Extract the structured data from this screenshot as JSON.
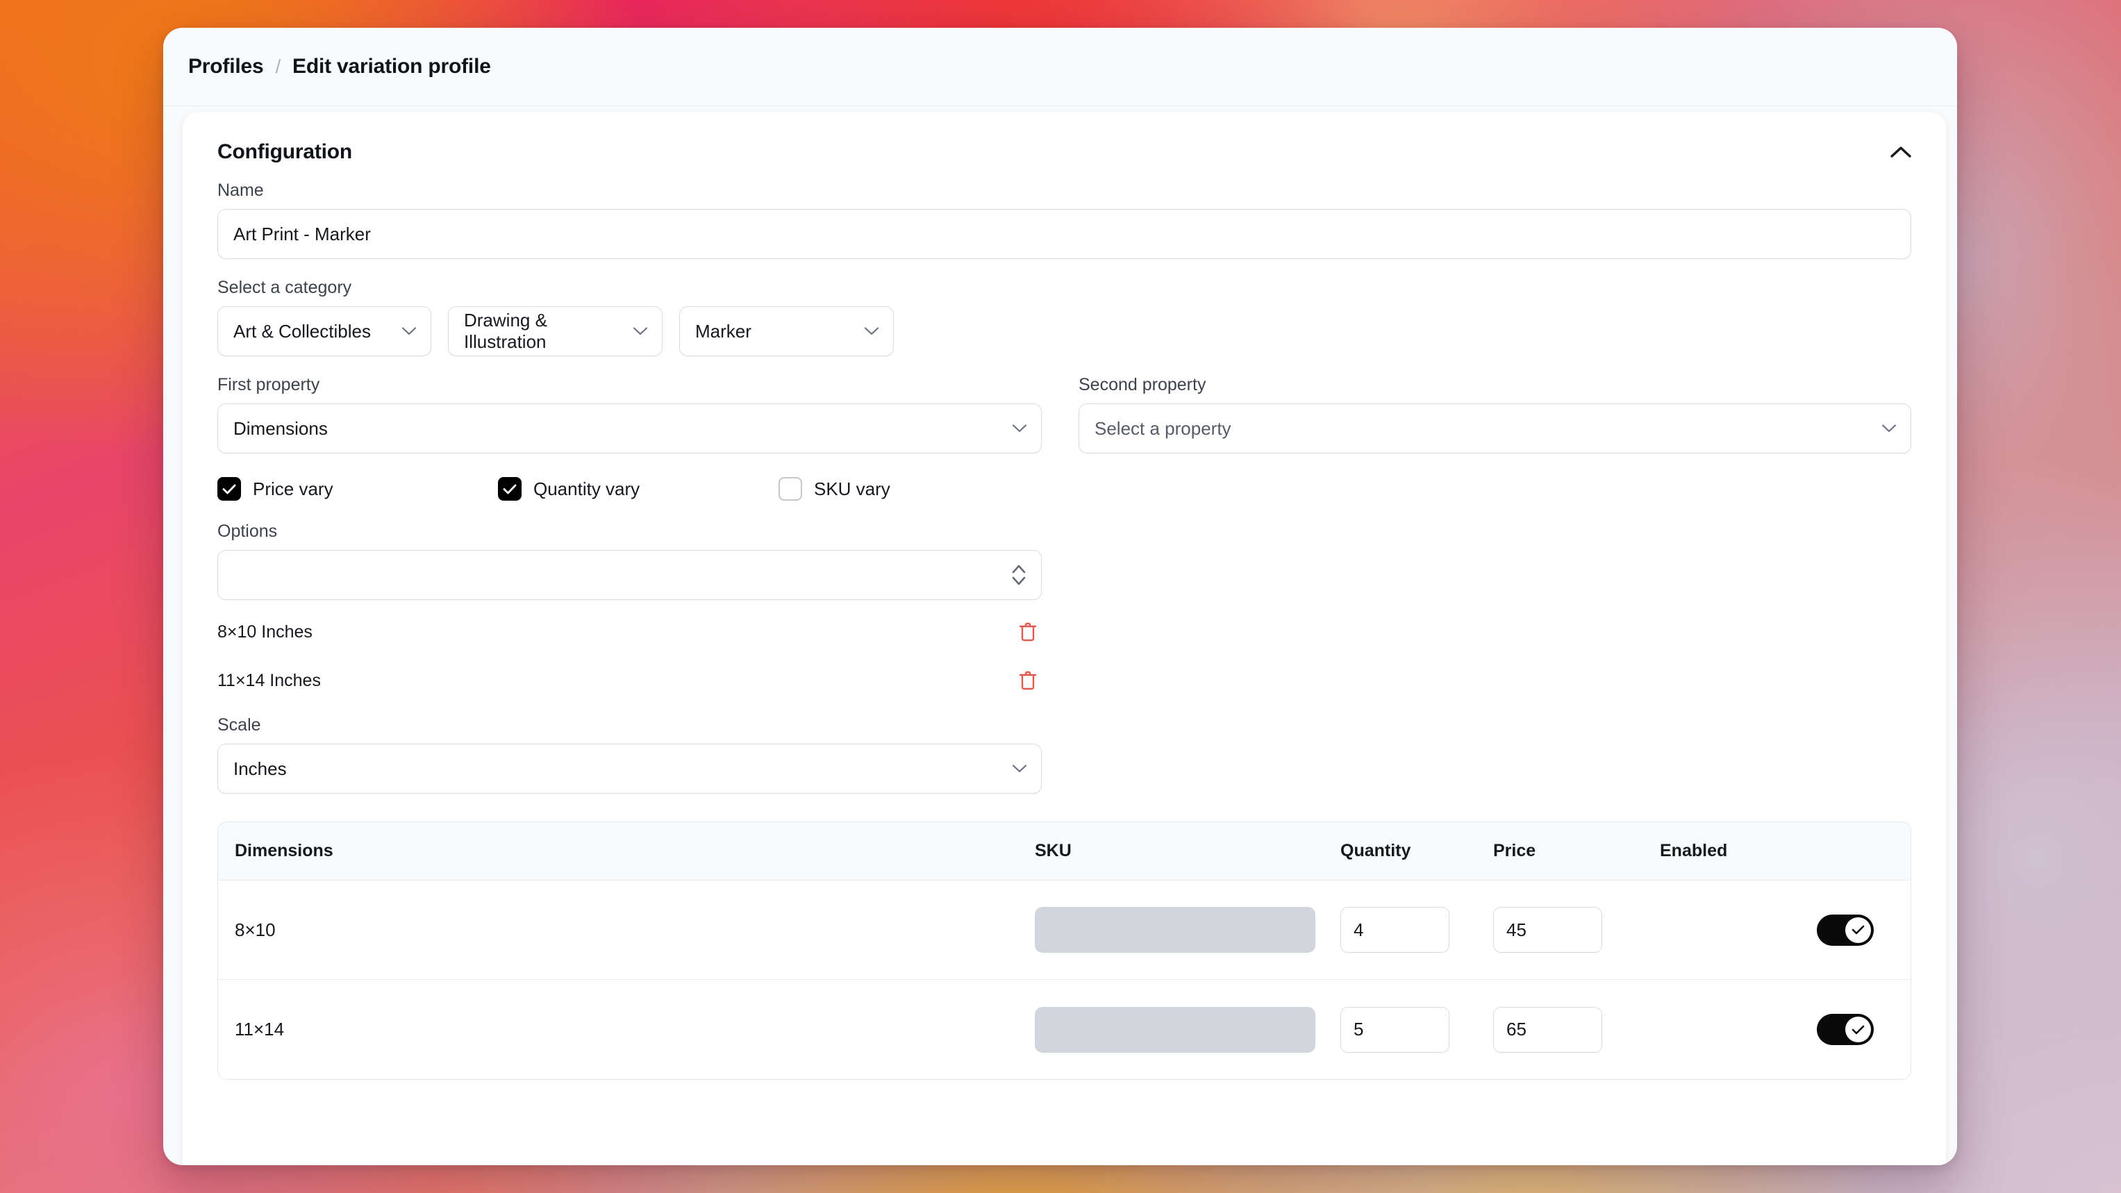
{
  "breadcrumb": {
    "root": "Profiles",
    "separator": "/",
    "current": "Edit variation profile"
  },
  "panel": {
    "title": "Configuration",
    "collapse_icon": "chevron-up-icon"
  },
  "form": {
    "name": {
      "label": "Name",
      "value": "Art Print - Marker"
    },
    "category": {
      "label": "Select a category",
      "selects": [
        {
          "value": "Art & Collectibles"
        },
        {
          "value": "Drawing & Illustration"
        },
        {
          "value": "Marker"
        }
      ]
    },
    "first_property": {
      "label": "First property",
      "value": "Dimensions"
    },
    "second_property": {
      "label": "Second property",
      "value": "Select a property",
      "is_placeholder": true
    },
    "vary_checkboxes": [
      {
        "label": "Price vary",
        "checked": true
      },
      {
        "label": "Quantity vary",
        "checked": true
      },
      {
        "label": "SKU vary",
        "checked": false
      }
    ],
    "options": {
      "label": "Options",
      "input_value": "",
      "stepper_icon": "chevron-up-down-icon",
      "items": [
        {
          "name": "8×10 Inches",
          "delete_icon": "trash-icon"
        },
        {
          "name": "11×14 Inches",
          "delete_icon": "trash-icon"
        }
      ]
    },
    "scale": {
      "label": "Scale",
      "value": "Inches"
    }
  },
  "table": {
    "headers": {
      "dimensions": "Dimensions",
      "sku": "SKU",
      "quantity": "Quantity",
      "price": "Price",
      "enabled": "Enabled"
    },
    "rows": [
      {
        "dimensions": "8×10",
        "sku": "",
        "quantity": "4",
        "price": "45",
        "enabled": true
      },
      {
        "dimensions": "11×14",
        "sku": "",
        "quantity": "5",
        "price": "65",
        "enabled": true
      }
    ]
  },
  "colors": {
    "accent_black": "#0a0a0a",
    "danger_red": "#e05a4f",
    "panel_bg": "#ffffff",
    "window_bg": "#f9fafb",
    "border": "#d9dde3",
    "sku_disabled": "#d2d6dc"
  }
}
